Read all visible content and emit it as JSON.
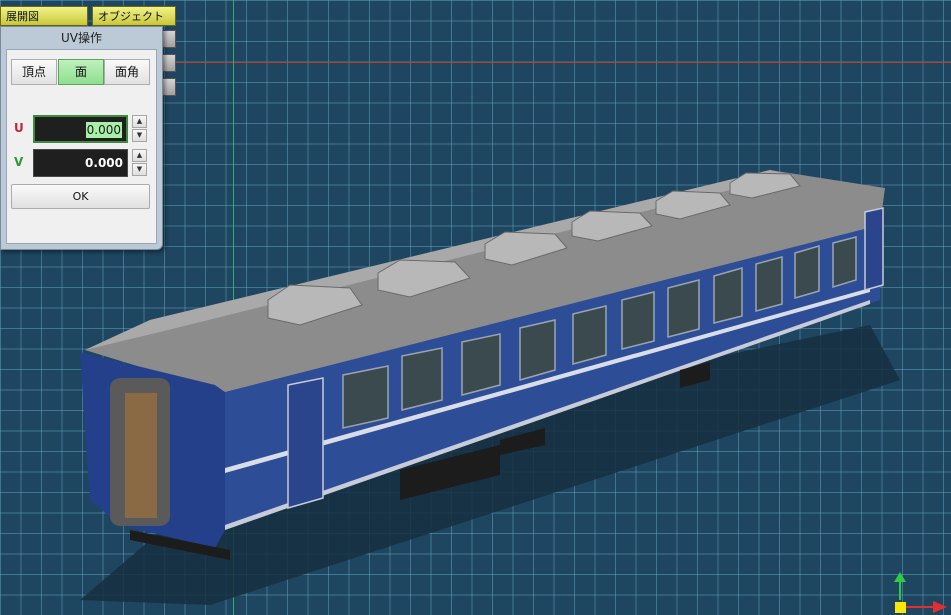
{
  "toolbar": {
    "tenkaizu_label": "展開図",
    "object_label": "オブジェクト"
  },
  "uv_panel": {
    "title": "UV操作",
    "tabs": [
      {
        "label": "頂点",
        "active": false
      },
      {
        "label": "面",
        "active": true
      },
      {
        "label": "面角",
        "active": false
      }
    ],
    "u": {
      "label": "U",
      "value": "0.000"
    },
    "v": {
      "label": "V",
      "value": "0.000"
    },
    "ok_label": "OK"
  },
  "colors": {
    "viewport_bg": "#1e4660",
    "grid_line": "#6eafcd",
    "axis_x": "#c0392b",
    "axis_y": "#2ecc71",
    "train_body": "#2f4f9a",
    "train_roof": "#8a8a8a",
    "active_tab": "#8fdf8f"
  },
  "icons": {
    "spin_up": "spin-up-arrow-icon",
    "spin_down": "spin-down-arrow-icon",
    "gizmo_y": "axis-y-arrow-icon",
    "gizmo_x": "axis-x-arrow-icon",
    "gizmo_origin": "axis-origin-icon"
  }
}
